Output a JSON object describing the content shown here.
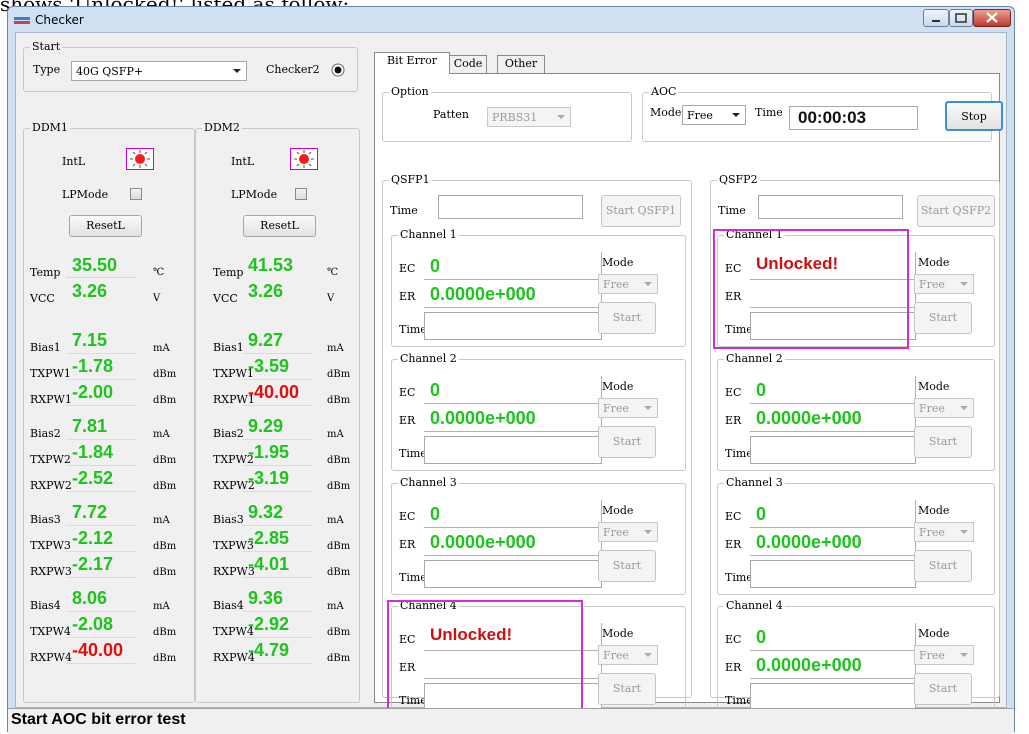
{
  "background_text": "shows 'Unlocked!' listed as follow:",
  "window": {
    "title": "Checker"
  },
  "start_group": {
    "label": "Start",
    "type_label": "Type",
    "type_value": "40G QSFP+",
    "checker2_label": "Checker2"
  },
  "ddm1": {
    "label": "DDM1",
    "intl_label": "IntL",
    "lpmode_label": "LPMode",
    "resetl_label": "ResetL",
    "temp_label": "Temp",
    "temp_value": "35.50",
    "temp_unit": "℃",
    "vcc_label": "VCC",
    "vcc_value": "3.26",
    "vcc_unit": "V",
    "rows": [
      {
        "label": "Bias1",
        "value": "7.15",
        "unit": "mA"
      },
      {
        "label": "TXPW1",
        "value": "-1.78",
        "unit": "dBm"
      },
      {
        "label": "RXPW1",
        "value": "-2.00",
        "unit": "dBm"
      },
      {
        "label": "Bias2",
        "value": "7.81",
        "unit": "mA"
      },
      {
        "label": "TXPW2",
        "value": "-1.84",
        "unit": "dBm"
      },
      {
        "label": "RXPW2",
        "value": "-2.52",
        "unit": "dBm"
      },
      {
        "label": "Bias3",
        "value": "7.72",
        "unit": "mA"
      },
      {
        "label": "TXPW3",
        "value": "-2.12",
        "unit": "dBm"
      },
      {
        "label": "RXPW3",
        "value": "-2.17",
        "unit": "dBm"
      },
      {
        "label": "Bias4",
        "value": "8.06",
        "unit": "mA"
      },
      {
        "label": "TXPW4",
        "value": "-2.08",
        "unit": "dBm"
      },
      {
        "label": "RXPW4",
        "value": "-40.00",
        "unit": "dBm"
      }
    ]
  },
  "ddm2": {
    "label": "DDM2",
    "intl_label": "IntL",
    "lpmode_label": "LPMode",
    "resetl_label": "ResetL",
    "temp_label": "Temp",
    "temp_value": "41.53",
    "temp_unit": "℃",
    "vcc_label": "VCC",
    "vcc_value": "3.26",
    "vcc_unit": "V",
    "rows": [
      {
        "label": "Bias1",
        "value": "9.27",
        "unit": "mA"
      },
      {
        "label": "TXPW1",
        "value": "-3.59",
        "unit": "dBm"
      },
      {
        "label": "RXPW1",
        "value": "-40.00",
        "unit": "dBm"
      },
      {
        "label": "Bias2",
        "value": "9.29",
        "unit": "mA"
      },
      {
        "label": "TXPW2",
        "value": "-1.95",
        "unit": "dBm"
      },
      {
        "label": "RXPW2",
        "value": "-3.19",
        "unit": "dBm"
      },
      {
        "label": "Bias3",
        "value": "9.32",
        "unit": "mA"
      },
      {
        "label": "TXPW3",
        "value": "-2.85",
        "unit": "dBm"
      },
      {
        "label": "RXPW3",
        "value": "-4.01",
        "unit": "dBm"
      },
      {
        "label": "Bias4",
        "value": "9.36",
        "unit": "mA"
      },
      {
        "label": "TXPW4",
        "value": "-2.92",
        "unit": "dBm"
      },
      {
        "label": "RXPW4",
        "value": "-4.79",
        "unit": "dBm"
      }
    ]
  },
  "tabs": [
    "Bit Error",
    "Code",
    "Other"
  ],
  "option": {
    "label": "Option",
    "patten_label": "Patten",
    "patten_value": "PRBS31"
  },
  "aoc": {
    "label": "AOC",
    "mode_label": "Mode",
    "mode_value": "Free",
    "time_label": "Time",
    "time_value": "00:00:03",
    "stop_label": "Stop"
  },
  "qsfp1": {
    "label": "QSFP1",
    "time_label": "Time",
    "start_label": "Start QSFP1",
    "channels": [
      {
        "title": "Channel 1",
        "ec": "0",
        "er": "0.0000e+000",
        "unlocked": ""
      },
      {
        "title": "Channel 2",
        "ec": "0",
        "er": "0.0000e+000",
        "unlocked": ""
      },
      {
        "title": "Channel 3",
        "ec": "0",
        "er": "0.0000e+000",
        "unlocked": ""
      },
      {
        "title": "Channel 4",
        "ec": "",
        "er": "",
        "unlocked": "Unlocked!"
      }
    ]
  },
  "qsfp2": {
    "label": "QSFP2",
    "time_label": "Time",
    "start_label": "Start QSFP2",
    "channels": [
      {
        "title": "Channel 1",
        "ec": "",
        "er": "",
        "unlocked": "Unlocked!"
      },
      {
        "title": "Channel 2",
        "ec": "0",
        "er": "0.0000e+000",
        "unlocked": ""
      },
      {
        "title": "Channel 3",
        "ec": "0",
        "er": "0.0000e+000",
        "unlocked": ""
      },
      {
        "title": "Channel 4",
        "ec": "0",
        "er": "0.0000e+000",
        "unlocked": ""
      }
    ]
  },
  "channel_common": {
    "ec_label": "EC",
    "er_label": "ER",
    "time_label": "Time",
    "mode_label": "Mode",
    "mode_value": "Free",
    "start_label": "Start"
  },
  "status": {
    "text": "Start AOC bit error test"
  },
  "colors": {
    "value_green": "#1ec31e",
    "value_red": "#e0100f",
    "highlight": "#d52bd5",
    "unlocked": "#cc1111"
  }
}
